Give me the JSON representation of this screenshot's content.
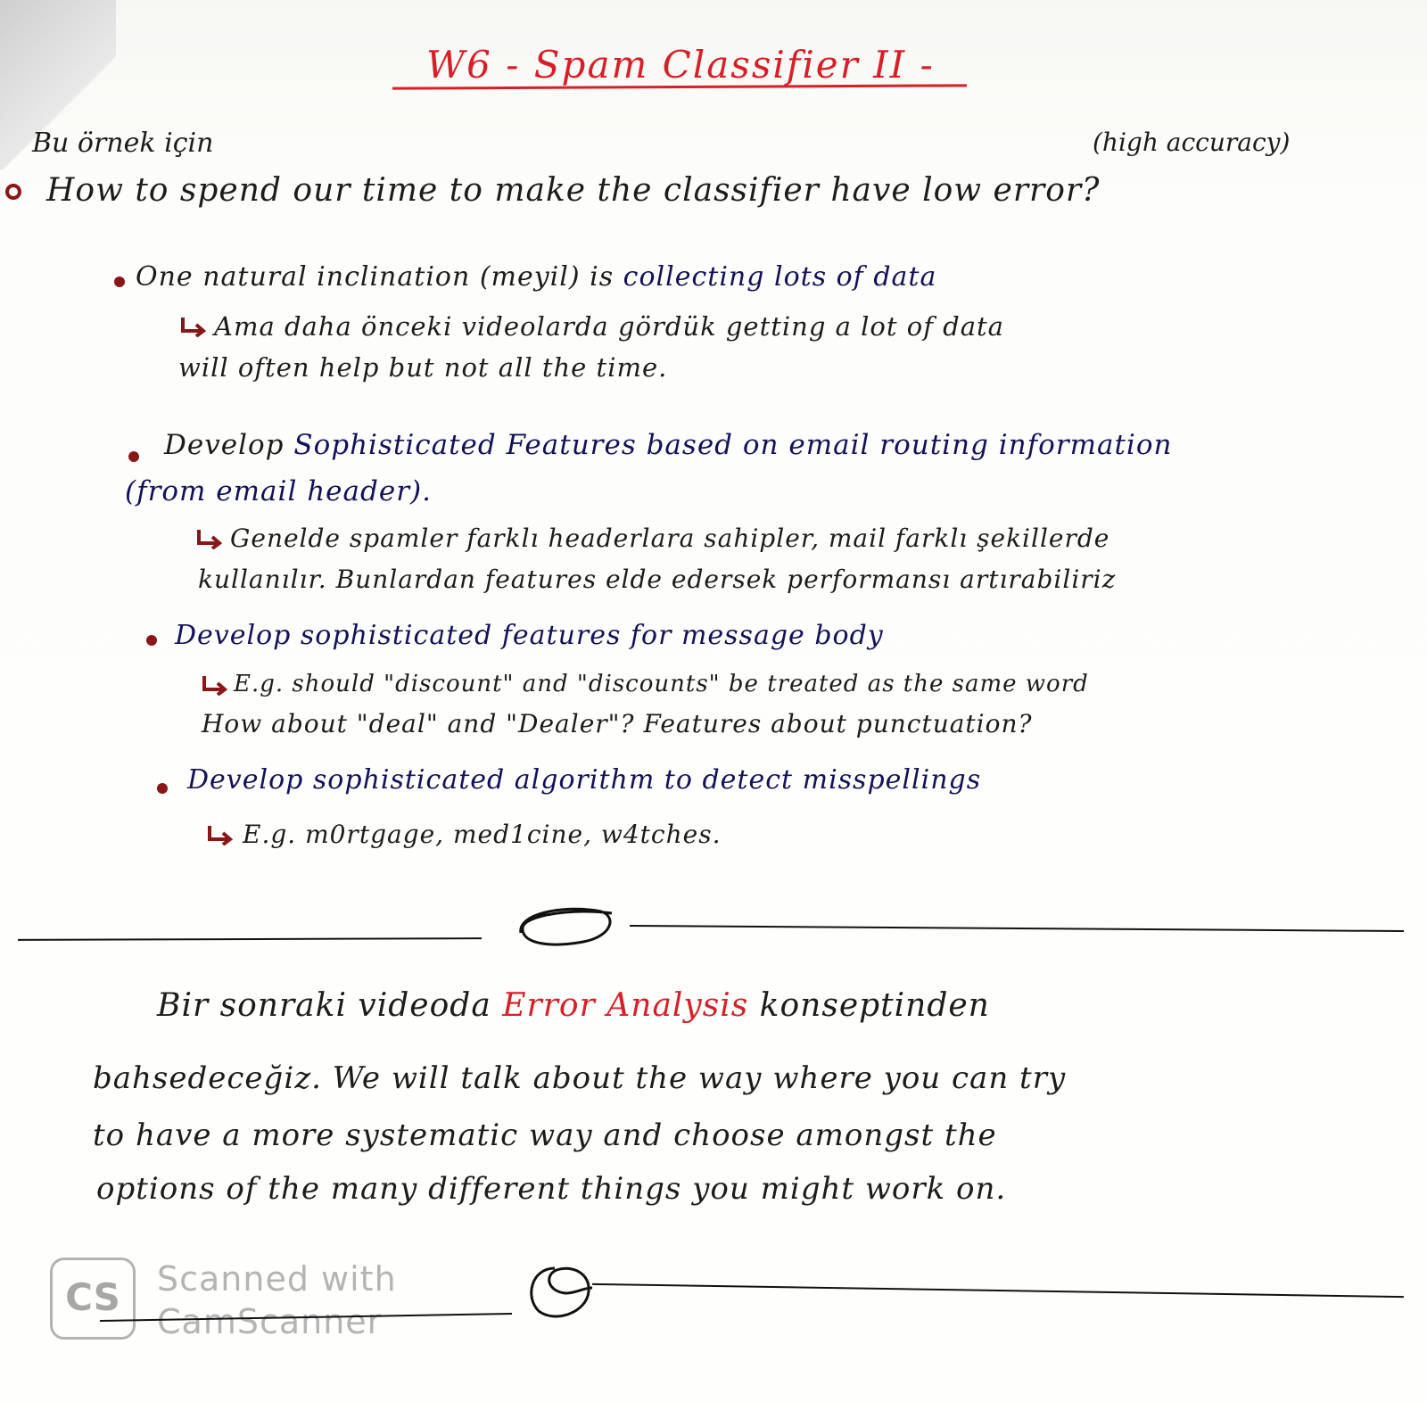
{
  "title": "W6 - Spam Classifier II -",
  "colors": {
    "heading_red": "#d71f27",
    "ink_blue": "#12125a",
    "ink_black": "#1c1c1c",
    "bullet_red": "#8a1717"
  },
  "header_note": {
    "left": "Bu örnek için",
    "right": "(high accuracy)"
  },
  "main_question": "How to spend our time to make the classifier have low error?",
  "bullets": [
    {
      "text_dark": "One natural inclination (meyil) is",
      "text_blue": "collecting lots of data",
      "sub": [
        "Ama daha önceki videolarda gördük getting a lot of data",
        "will often help but not all the time."
      ]
    },
    {
      "text_dark": "Develop",
      "text_blue": "Sophisticated Features based on email routing information",
      "text_blue_2": "(from email header).",
      "sub": [
        "Genelde spamler farklı headerlara sahipler, mail farklı şekillerde",
        "kullanılır. Bunlardan features elde edersek performansı artırabiliriz"
      ]
    },
    {
      "text_blue": "Develop sophisticated features for message body",
      "sub": [
        "E.g. should \"discount\" and \"discounts\" be treated as the same word",
        "How about \"deal\" and \"Dealer\"? Features about punctuation?"
      ]
    },
    {
      "text_blue": "Develop sophisticated algorithm to detect misspellings",
      "sub": [
        "E.g. m0rtgage, med1cine, w4tches."
      ]
    }
  ],
  "closing": {
    "line1_a": "Bir sonraki videoda",
    "line1_red": "Error Analysis",
    "line1_b": "konseptinden",
    "line2": "bahsedeceğiz. We will talk about the way where you can try",
    "line3": "to have a more systematic way and choose amongst the",
    "line4": "options of the many different things you might work on."
  },
  "watermark": {
    "logo": "CS",
    "line1": "Scanned with",
    "line2": "CamScanner"
  }
}
